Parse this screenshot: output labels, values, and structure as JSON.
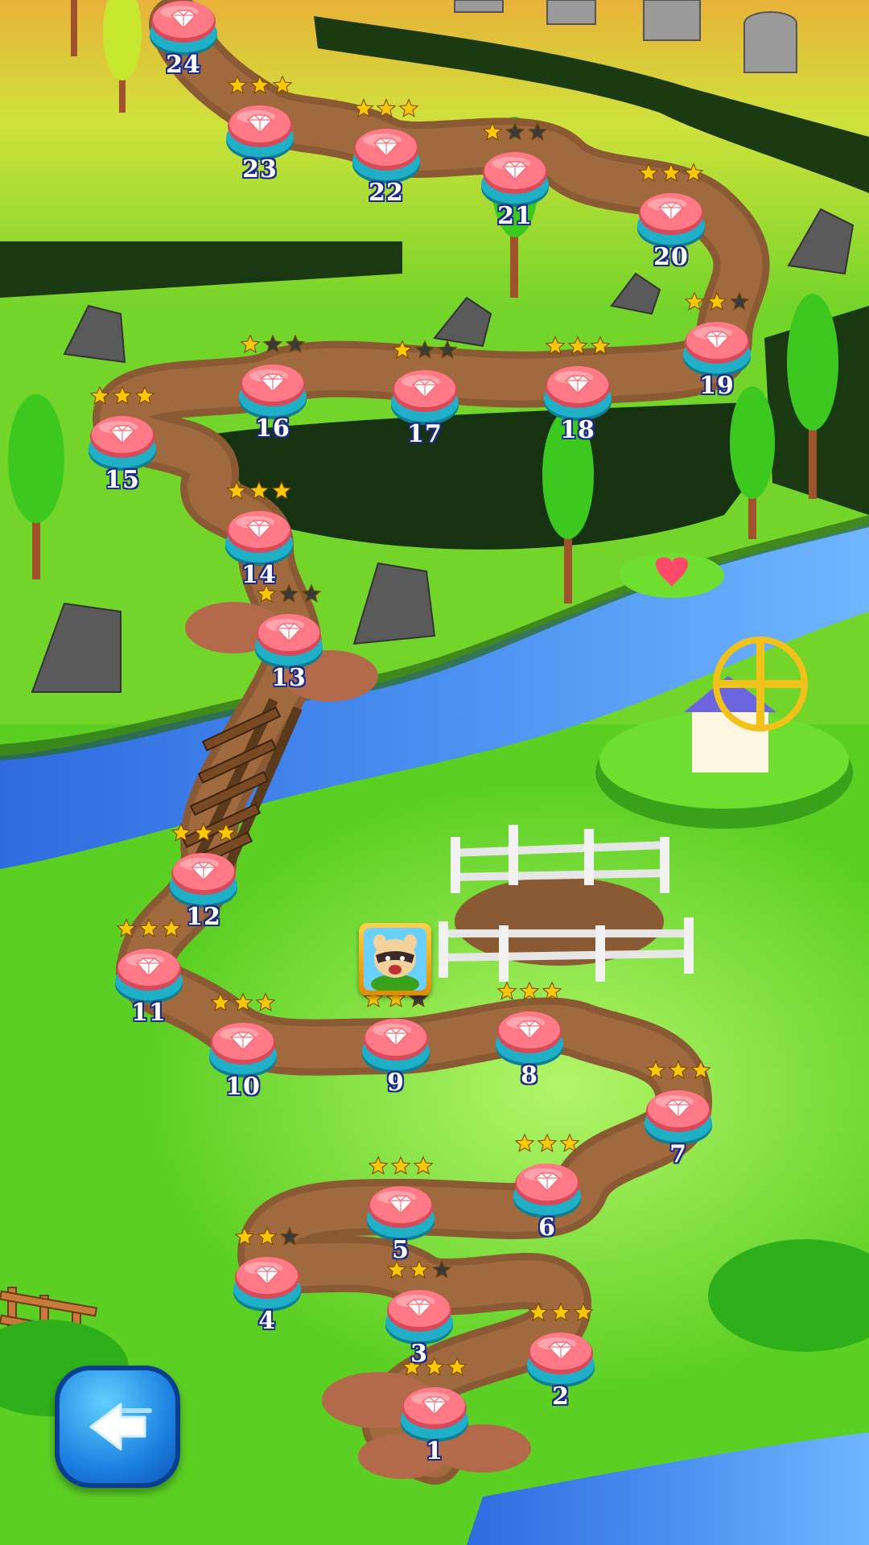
{
  "game": {
    "map_name": "",
    "levels": [
      {
        "number": "1",
        "stars": 3
      },
      {
        "number": "2",
        "stars": 3
      },
      {
        "number": "3",
        "stars": 2
      },
      {
        "number": "4",
        "stars": 2
      },
      {
        "number": "5",
        "stars": 3
      },
      {
        "number": "6",
        "stars": 3
      },
      {
        "number": "7",
        "stars": 3
      },
      {
        "number": "8",
        "stars": 3
      },
      {
        "number": "9",
        "stars": 2
      },
      {
        "number": "10",
        "stars": 3
      },
      {
        "number": "11",
        "stars": 3
      },
      {
        "number": "12",
        "stars": 3
      },
      {
        "number": "13",
        "stars": 1
      },
      {
        "number": "14",
        "stars": 3
      },
      {
        "number": "15",
        "stars": 3
      },
      {
        "number": "16",
        "stars": 1
      },
      {
        "number": "17",
        "stars": 1
      },
      {
        "number": "18",
        "stars": 3
      },
      {
        "number": "19",
        "stars": 2
      },
      {
        "number": "20",
        "stars": 3
      },
      {
        "number": "21",
        "stars": 1
      },
      {
        "number": "22",
        "stars": 3
      },
      {
        "number": "23",
        "stars": 3
      },
      {
        "number": "24",
        "stars": 0
      }
    ],
    "current_level": "9",
    "back_button": {
      "icon": "back-arrow-icon"
    },
    "colors": {
      "grass": "#55c81f",
      "path": "#8a5a34",
      "river": "#3f7fe8",
      "star_filled": "#ffc800",
      "star_empty": "#3a3a3a",
      "button_top": "#ff7a86",
      "button_base": "#1fb0c8",
      "number_text": "#ffffff",
      "number_outline": "#1a2a8a"
    }
  }
}
